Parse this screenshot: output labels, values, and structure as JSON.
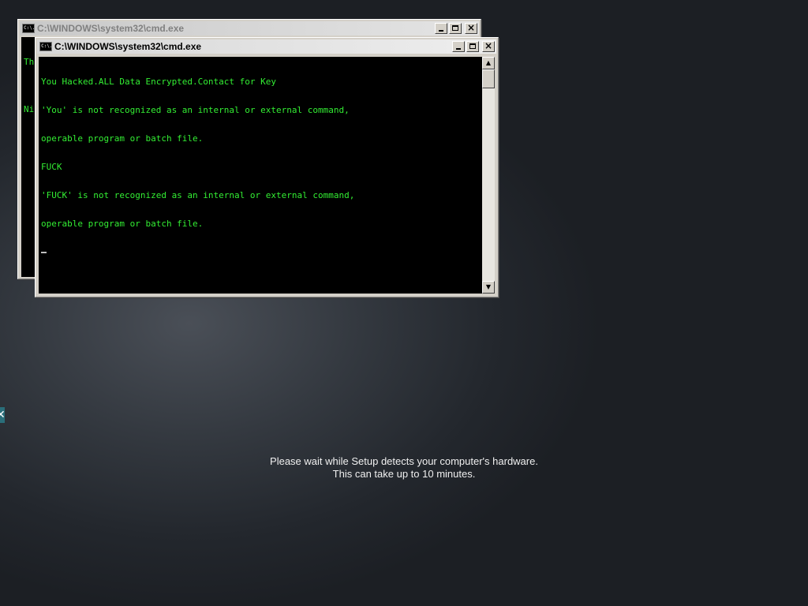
{
  "back_window": {
    "title": "C:\\WINDOWS\\system32\\cmd.exe",
    "icon": "cmd-app-icon",
    "icon_text": "C:\\.",
    "lines": [
      "Th",
      "",
      "Ni"
    ]
  },
  "front_window": {
    "title": "C:\\WINDOWS\\system32\\cmd.exe",
    "icon": "cmd-app-icon",
    "icon_text": "C:\\.",
    "lines": [
      "You Hacked.ALL Data Encrypted.Contact for Key",
      "'You' is not recognized as an internal or external command,",
      "operable program or batch file.",
      "FUCK",
      "'FUCK' is not recognized as an internal or external command,",
      "operable program or batch file."
    ],
    "scroll_up": "▲",
    "scroll_down": "▼"
  },
  "titlebar_buttons": {
    "close": "×"
  },
  "setup": {
    "line1": "Please wait while Setup detects your computer's hardware.",
    "line2": "This can take up to 10 minutes."
  },
  "colors": {
    "console_text": "#33ee33",
    "console_bg": "#000000",
    "background": "#2b2f35"
  }
}
